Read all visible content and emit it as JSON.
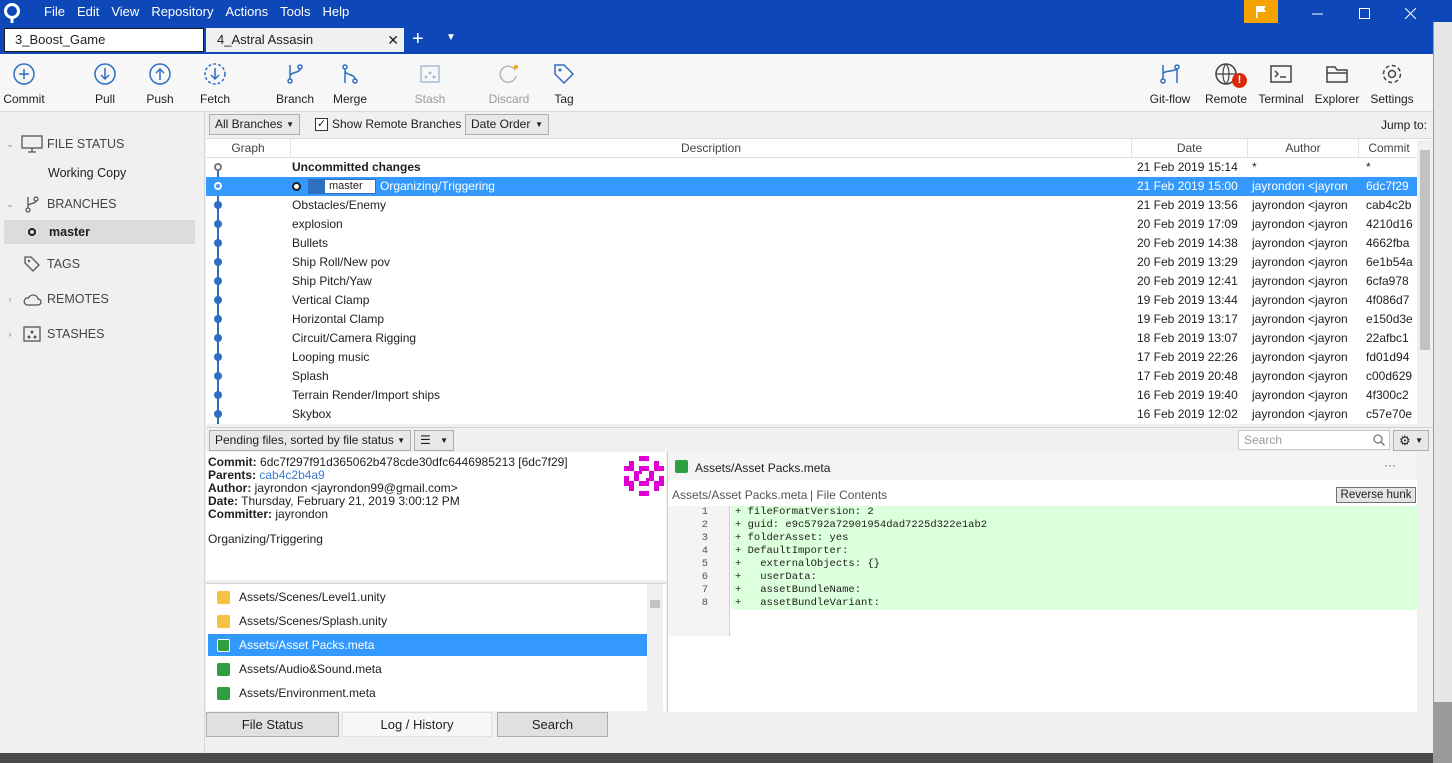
{
  "menu": [
    "File",
    "Edit",
    "View",
    "Repository",
    "Actions",
    "Tools",
    "Help"
  ],
  "tabs": [
    {
      "label": "3_Boost_Game",
      "active": false
    },
    {
      "label": "4_Astral Assasin",
      "active": true
    }
  ],
  "toolbar": {
    "commit": "Commit",
    "pull": "Pull",
    "push": "Push",
    "fetch": "Fetch",
    "branch": "Branch",
    "merge": "Merge",
    "stash": "Stash",
    "discard": "Discard",
    "tag": "Tag",
    "gitflow": "Git-flow",
    "remote": "Remote",
    "remote_badge": "!",
    "terminal": "Terminal",
    "explorer": "Explorer",
    "settings": "Settings"
  },
  "sidebar": {
    "file_status": "FILE STATUS",
    "working_copy": "Working Copy",
    "branches": "BRANCHES",
    "current_branch": "master",
    "tags": "TAGS",
    "remotes": "REMOTES",
    "stashes": "STASHES"
  },
  "filter": {
    "branches": "All Branches",
    "show_remote": "Show Remote Branches",
    "order": "Date Order",
    "jump": "Jump to:"
  },
  "columns": {
    "graph": "Graph",
    "description": "Description",
    "date": "Date",
    "author": "Author",
    "commit": "Commit"
  },
  "commits": [
    {
      "desc": "Uncommitted changes",
      "date": "21 Feb 2019 15:14",
      "author": "*",
      "hash": "*"
    },
    {
      "desc": "Organizing/Triggering",
      "date": "21 Feb 2019 15:00",
      "author": "jayrondon <jayron",
      "hash": "6dc7f29",
      "branch": "master"
    },
    {
      "desc": "Obstacles/Enemy",
      "date": "21 Feb 2019 13:56",
      "author": "jayrondon <jayron",
      "hash": "cab4c2b"
    },
    {
      "desc": "explosion",
      "date": "20 Feb 2019 17:09",
      "author": "jayrondon <jayron",
      "hash": "4210d16"
    },
    {
      "desc": "Bullets",
      "date": "20 Feb 2019 14:38",
      "author": "jayrondon <jayron",
      "hash": "4662fba"
    },
    {
      "desc": "Ship Roll/New pov",
      "date": "20 Feb 2019 13:29",
      "author": "jayrondon <jayron",
      "hash": "6e1b54a"
    },
    {
      "desc": "Ship Pitch/Yaw",
      "date": "20 Feb 2019 12:41",
      "author": "jayrondon <jayron",
      "hash": "6cfa978"
    },
    {
      "desc": "Vertical Clamp",
      "date": "19 Feb 2019 13:44",
      "author": "jayrondon <jayron",
      "hash": "4f086d7"
    },
    {
      "desc": "Horizontal Clamp",
      "date": "19 Feb 2019 13:17",
      "author": "jayrondon <jayron",
      "hash": "e150d3e"
    },
    {
      "desc": "Circuit/Camera Rigging",
      "date": "18 Feb 2019 13:07",
      "author": "jayrondon <jayron",
      "hash": "22afbc1"
    },
    {
      "desc": "Looping music",
      "date": "17 Feb 2019 22:26",
      "author": "jayrondon <jayron",
      "hash": "fd01d94"
    },
    {
      "desc": "Splash",
      "date": "17 Feb 2019 20:48",
      "author": "jayrondon <jayron",
      "hash": "c00d629"
    },
    {
      "desc": "Terrain Render/Import ships",
      "date": "16 Feb 2019 19:40",
      "author": "jayrondon <jayron",
      "hash": "4f300c2"
    },
    {
      "desc": "Skybox",
      "date": "16 Feb 2019 12:02",
      "author": "jayrondon <jayron",
      "hash": "c57e70e"
    }
  ],
  "pending": {
    "label": "Pending files, sorted by file status",
    "search_placeholder": "Search"
  },
  "detail": {
    "commit_label": "Commit:",
    "commit_value": "6dc7f297f91d365062b478cde30dfc6446985213 [6dc7f29]",
    "parents_label": "Parents:",
    "parents_value": "cab4c2b4a9",
    "author_label": "Author:",
    "author_value": "jayrondon <jayrondon99@gmail.com>",
    "date_label": "Date:",
    "date_value": "Thursday, February 21, 2019 3:00:12 PM",
    "committer_label": "Committer:",
    "committer_value": "jayrondon",
    "message": "Organizing/Triggering"
  },
  "files": [
    {
      "name": "Assets/Scenes/Level1.unity",
      "status": "modified"
    },
    {
      "name": "Assets/Scenes/Splash.unity",
      "status": "modified"
    },
    {
      "name": "Assets/Asset Packs.meta",
      "status": "added",
      "selected": true
    },
    {
      "name": "Assets/Audio&Sound.meta",
      "status": "added"
    },
    {
      "name": "Assets/Environment.meta",
      "status": "added"
    }
  ],
  "diff": {
    "file": "Assets/Asset Packs.meta",
    "sub_file": "Assets/Asset Packs.meta",
    "sub_sep": "| File Contents",
    "more": "···",
    "reverse": "Reverse hunk",
    "lines": [
      {
        "n": "1",
        "text": "+ fileFormatVersion: 2"
      },
      {
        "n": "2",
        "text": "+ guid: e9c5792a72901954dad7225d322e1ab2"
      },
      {
        "n": "3",
        "text": "+ folderAsset: yes"
      },
      {
        "n": "4",
        "text": "+ DefaultImporter:"
      },
      {
        "n": "5",
        "text": "+   externalObjects: {}"
      },
      {
        "n": "6",
        "text": "+   userData:"
      },
      {
        "n": "7",
        "text": "+   assetBundleName:"
      },
      {
        "n": "8",
        "text": "+   assetBundleVariant:"
      }
    ]
  },
  "view_tabs": {
    "file_status": "File Status",
    "log": "Log / History",
    "search": "Search"
  }
}
